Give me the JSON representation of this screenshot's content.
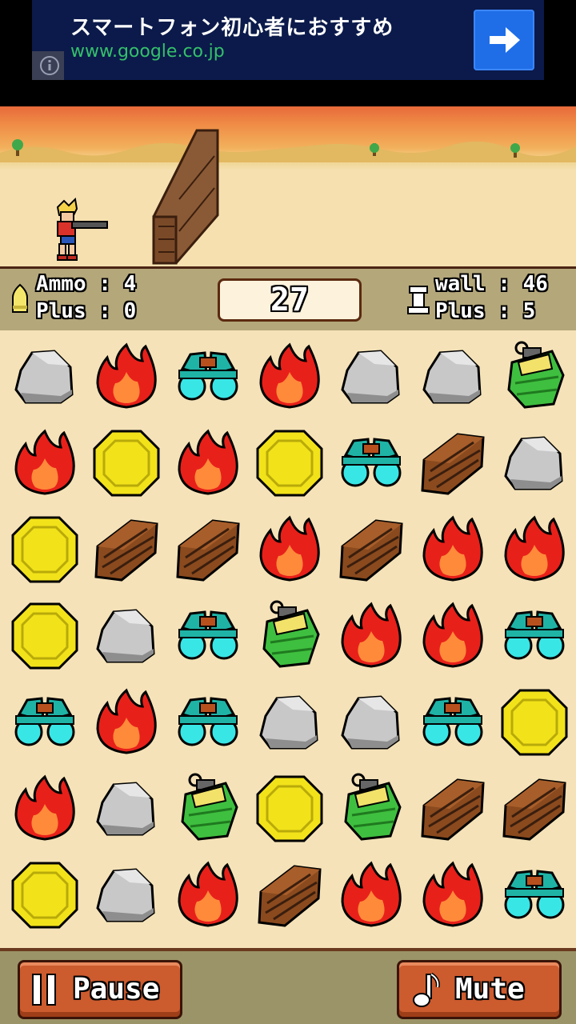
{
  "ad": {
    "title": "スマートフォン初心者におすすめ",
    "url": "www.google.co.jp"
  },
  "hud": {
    "ammo_label": "Ammo",
    "ammo_value": "4",
    "plus_left_label": "Plus",
    "plus_left_value": "0",
    "timer": "27",
    "wall_label": "wall",
    "wall_value": "46",
    "plus_right_label": "Plus",
    "plus_right_value": "5"
  },
  "board": {
    "rows": [
      [
        "rock",
        "fire",
        "binoculars",
        "fire",
        "rock",
        "rock",
        "grenade"
      ],
      [
        "fire",
        "coin",
        "fire",
        "coin",
        "binoculars",
        "wood",
        "rock"
      ],
      [
        "coin",
        "wood",
        "wood",
        "fire",
        "wood",
        "fire",
        "fire"
      ],
      [
        "coin",
        "rock",
        "binoculars",
        "grenade",
        "fire",
        "fire",
        "binoculars"
      ],
      [
        "binoculars",
        "fire",
        "binoculars",
        "rock",
        "rock",
        "binoculars",
        "coin"
      ],
      [
        "fire",
        "rock",
        "grenade",
        "coin",
        "grenade",
        "wood",
        "wood"
      ],
      [
        "coin",
        "rock",
        "fire",
        "wood",
        "fire",
        "fire",
        "binoculars"
      ]
    ]
  },
  "footer": {
    "pause_label": "Pause",
    "mute_label": "Mute"
  }
}
